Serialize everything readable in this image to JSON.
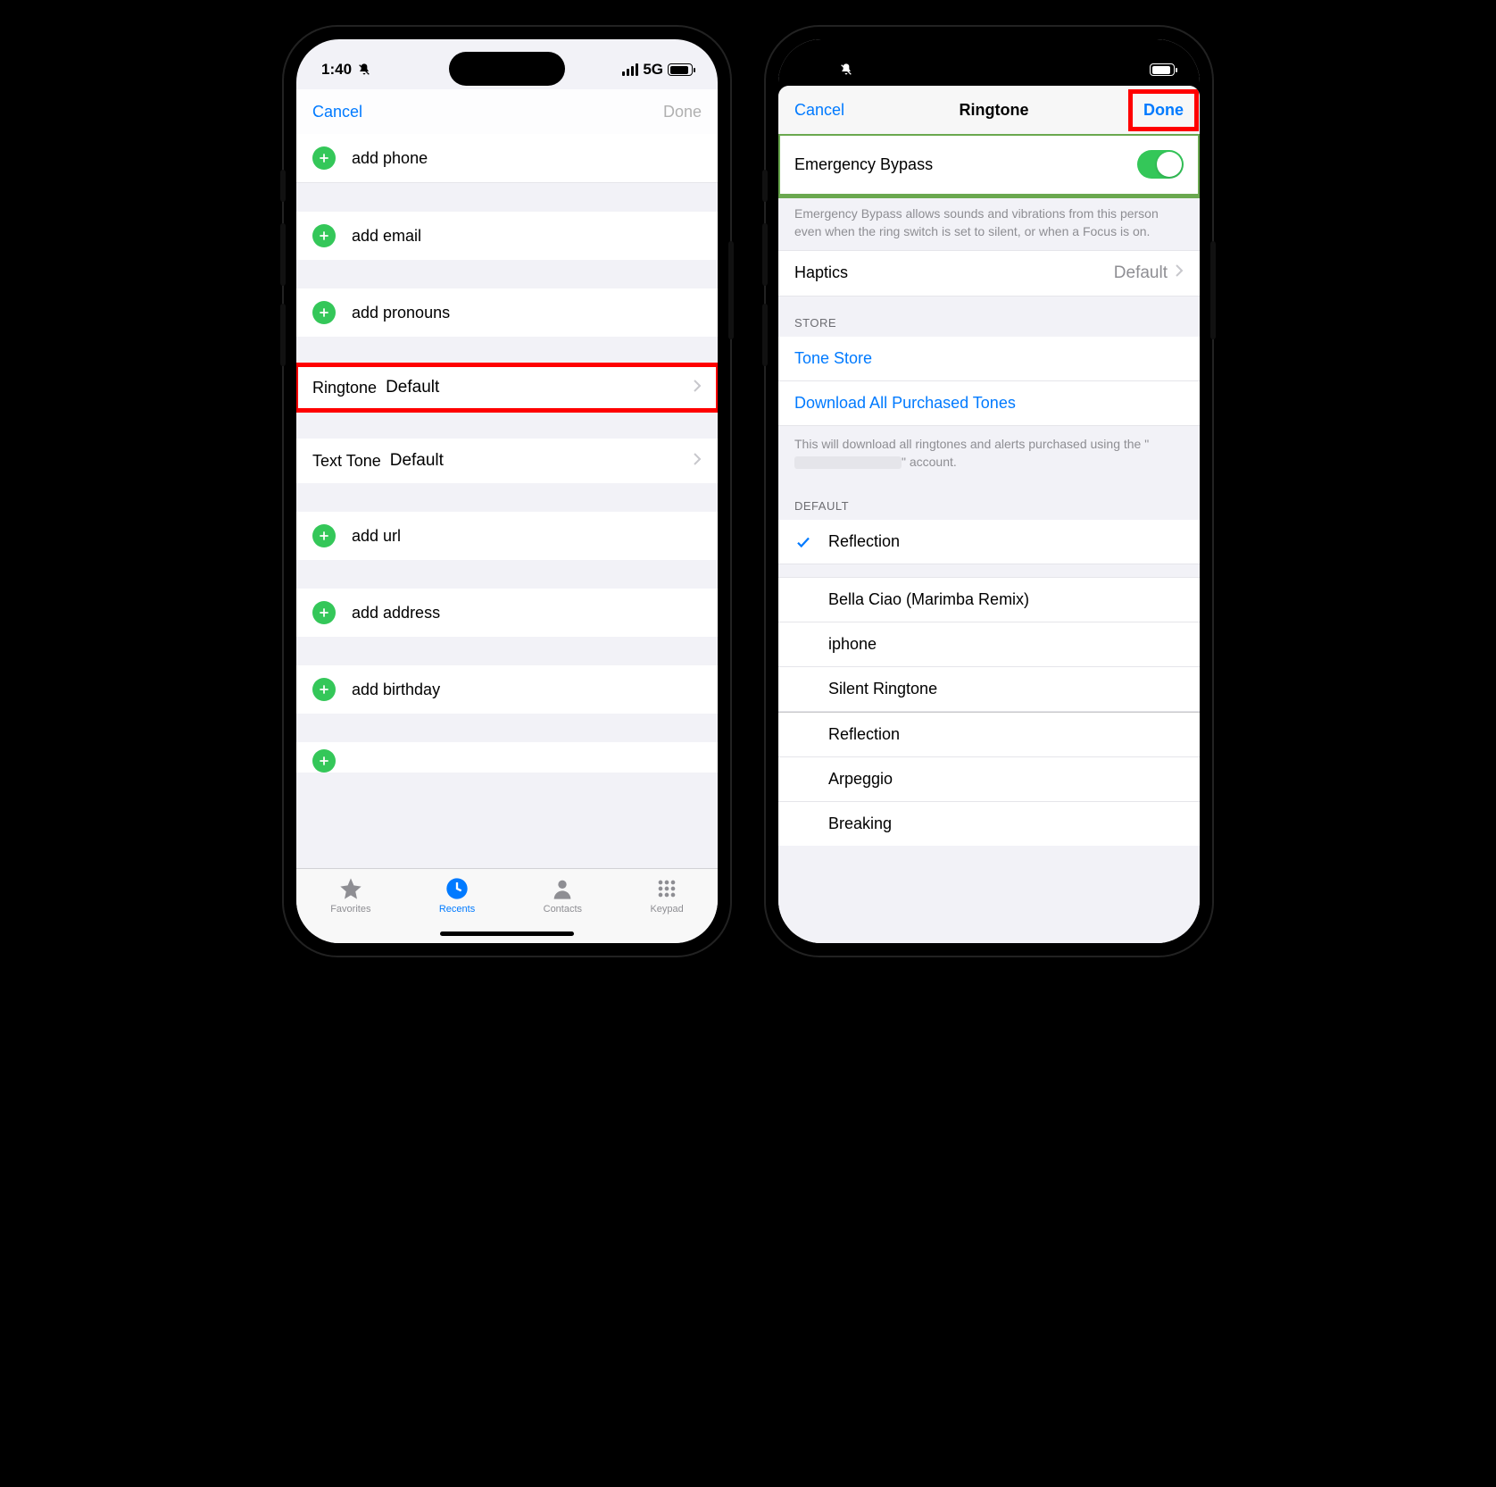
{
  "status": {
    "time": "1:40",
    "network": "5G"
  },
  "left": {
    "nav": {
      "cancel": "Cancel",
      "done": "Done"
    },
    "rows": {
      "add_phone": "add phone",
      "add_email": "add email",
      "add_pronouns": "add pronouns",
      "ringtone_label": "Ringtone",
      "ringtone_value": "Default",
      "texttone_label": "Text Tone",
      "texttone_value": "Default",
      "add_url": "add url",
      "add_address": "add address",
      "add_birthday": "add birthday"
    },
    "tabs": {
      "favorites": "Favorites",
      "recents": "Recents",
      "contacts": "Contacts",
      "keypad": "Keypad"
    }
  },
  "right": {
    "nav": {
      "cancel": "Cancel",
      "title": "Ringtone",
      "done": "Done"
    },
    "bypass": {
      "label": "Emergency Bypass",
      "on": true,
      "footer": "Emergency Bypass allows sounds and vibrations from this person even when the ring switch is set to silent, or when a Focus is on."
    },
    "haptics": {
      "label": "Haptics",
      "value": "Default"
    },
    "store": {
      "header": "STORE",
      "tone_store": "Tone Store",
      "download": "Download All Purchased Tones",
      "footer_pre": "This will download all ringtones and alerts purchased using the \"",
      "footer_post": "\" account."
    },
    "default": {
      "header": "DEFAULT",
      "selected": "Reflection",
      "items": [
        "Bella Ciao (Marimba Remix)",
        "iphone",
        "Silent Ringtone",
        "Reflection",
        "Arpeggio",
        "Breaking"
      ]
    }
  }
}
